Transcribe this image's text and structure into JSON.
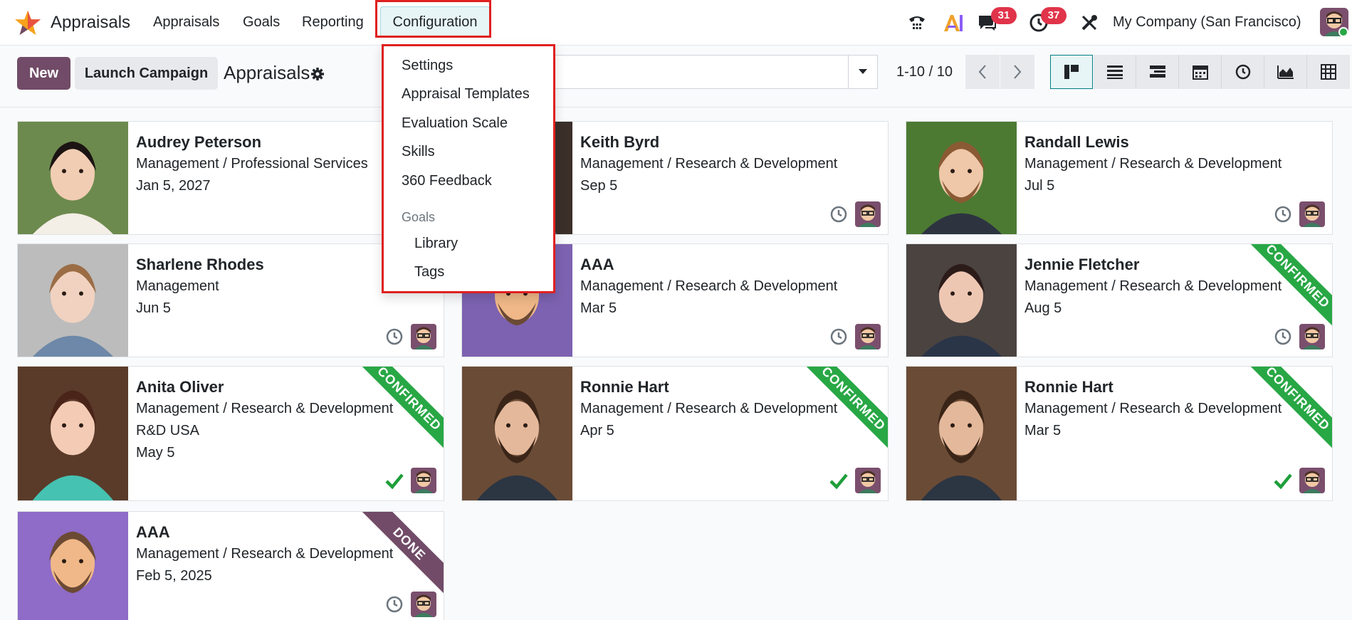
{
  "navbar": {
    "app_name": "Appraisals",
    "menu": [
      "Appraisals",
      "Goals",
      "Reporting"
    ],
    "active_menu": "Configuration",
    "messages_badge": "31",
    "activities_badge": "37",
    "company": "My Company (San Francisco)",
    "icons": [
      "phone-icon",
      "ai-icon",
      "chat-icon",
      "clock-icon",
      "tools-icon"
    ]
  },
  "control": {
    "new_label": "New",
    "launch_label": "Launch Campaign",
    "title": "Appraisals",
    "pager": "1-10 / 10",
    "views": [
      "kanban",
      "list",
      "grouped-list",
      "calendar",
      "activity",
      "graph",
      "pivot"
    ],
    "active_view": "kanban"
  },
  "dropdown": {
    "items": [
      "Settings",
      "Appraisal Templates",
      "Evaluation Scale",
      "Skills",
      "360 Feedback"
    ],
    "section": "Goals",
    "sub_items": [
      "Library",
      "Tags"
    ]
  },
  "cards": [
    {
      "name": "Audrey Peterson",
      "lines": [
        "Management / Professional Services",
        "Jan 5, 2027"
      ],
      "status": "clock",
      "ribbon": ""
    },
    {
      "name": "Keith Byrd",
      "lines": [
        "Management / Research & Development",
        "Sep 5"
      ],
      "status": "clock",
      "ribbon": ""
    },
    {
      "name": "Randall Lewis",
      "lines": [
        "Management / Research & Development",
        "Jul 5"
      ],
      "status": "clock",
      "ribbon": ""
    },
    {
      "name": "Sharlene Rhodes",
      "lines": [
        "Management",
        "Jun 5"
      ],
      "status": "clock",
      "ribbon": ""
    },
    {
      "name": "AAA",
      "lines": [
        "Management / Research & Development",
        "Mar 5"
      ],
      "status": "clock",
      "ribbon": ""
    },
    {
      "name": "Jennie Fletcher",
      "lines": [
        "Management / Research & Development",
        "Aug 5"
      ],
      "status": "clock",
      "ribbon": "CONFIRMED"
    },
    {
      "name": "Anita Oliver",
      "lines": [
        "Management / Research & Development",
        "R&D USA",
        "May 5"
      ],
      "status": "check",
      "ribbon": "CONFIRMED"
    },
    {
      "name": "Ronnie Hart",
      "lines": [
        "Management / Research & Development",
        "Apr 5"
      ],
      "status": "check",
      "ribbon": "CONFIRMED"
    },
    {
      "name": "Ronnie Hart",
      "lines": [
        "Management / Research & Development",
        "Mar 5"
      ],
      "status": "check",
      "ribbon": "CONFIRMED"
    },
    {
      "name": "AAA",
      "lines": [
        "Management / Research & Development",
        "Feb 5, 2025"
      ],
      "status": "clock",
      "ribbon": "DONE"
    }
  ],
  "colors": {
    "brand": "#714b67",
    "confirmed": "#28a745",
    "badge": "#e0344a",
    "highlight": "#e02020"
  }
}
